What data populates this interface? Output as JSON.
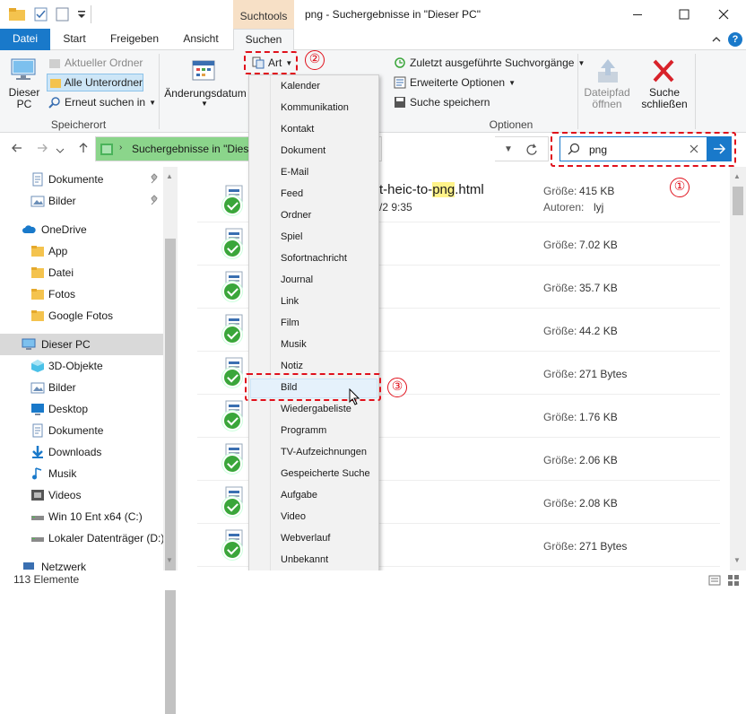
{
  "window": {
    "context_tab": "Suchtools",
    "title": "png - Suchergebnisse in \"Dieser PC\""
  },
  "ribbon_tabs": [
    "Datei",
    "Start",
    "Freigeben",
    "Ansicht",
    "Suchen"
  ],
  "ribbon": {
    "this_pc": "Dieser PC",
    "current_folder": "Aktueller Ordner",
    "all_subfolders": "Alle Unterordner",
    "search_again": "Erneut suchen in",
    "group_location": "Speicherort",
    "date_modified": "Änderungsdatum",
    "kind_button": "Art",
    "recent_searches": "Zuletzt ausgeführte Suchvorgänge",
    "advanced_options": "Erweiterte Optionen",
    "save_search": "Suche speichern",
    "group_options": "Optionen",
    "open_file_location": "Dateipfad öffnen",
    "close_search": "Suche schließen"
  },
  "address": {
    "path": "Suchergebnisse in \"Dieser",
    "search_value": "png"
  },
  "nav": [
    {
      "label": "Dokumente",
      "icon": "document-icon",
      "pinned": true
    },
    {
      "label": "Bilder",
      "icon": "pictures-icon",
      "pinned": true
    },
    {
      "label": "OneDrive",
      "icon": "cloud-icon"
    },
    {
      "label": "App",
      "icon": "folder-icon"
    },
    {
      "label": "Datei",
      "icon": "folder-icon"
    },
    {
      "label": "Fotos",
      "icon": "folder-icon"
    },
    {
      "label": "Google Fotos",
      "icon": "folder-icon"
    },
    {
      "label": "Dieser PC",
      "icon": "computer-icon",
      "selected": true
    },
    {
      "label": "3D-Objekte",
      "icon": "cube-icon"
    },
    {
      "label": "Bilder",
      "icon": "pictures-icon"
    },
    {
      "label": "Desktop",
      "icon": "desktop-icon"
    },
    {
      "label": "Dokumente",
      "icon": "document-icon"
    },
    {
      "label": "Downloads",
      "icon": "download-icon"
    },
    {
      "label": "Musik",
      "icon": "music-icon"
    },
    {
      "label": "Videos",
      "icon": "video-icon"
    },
    {
      "label": "Win 10 Ent x64 (C:)",
      "icon": "drive-icon"
    },
    {
      "label": "Lokaler Datenträger (D:)",
      "icon": "drive-icon"
    },
    {
      "label": "Netzwerk",
      "icon": "network-icon"
    }
  ],
  "results": {
    "first_name_prefix": "t-heic-to-",
    "first_name_match": "png",
    "first_name_suffix": ".html",
    "first_date": "/2 9:35",
    "size_label": "Größe:",
    "authors_label": "Autoren:",
    "first_author": "lyj",
    "sizes": [
      "415 KB",
      "7.02 KB",
      "35.7 KB",
      "44.2 KB",
      "271 Bytes",
      "1.76 KB",
      "2.06 KB",
      "2.08 KB",
      "271 Bytes"
    ]
  },
  "kind_menu": [
    "Kalender",
    "Kommunikation",
    "Kontakt",
    "Dokument",
    "E-Mail",
    "Feed",
    "Ordner",
    "Spiel",
    "Sofortnachricht",
    "Journal",
    "Link",
    "Film",
    "Musik",
    "Notiz",
    "Bild",
    "Wiedergabeliste",
    "Programm",
    "TV-Aufzeichnungen",
    "Gespeicherte Suche",
    "Aufgabe",
    "Video",
    "Webverlauf",
    "Unbekannt"
  ],
  "markers": [
    "①",
    "②",
    "③"
  ],
  "status": {
    "count": "113 Elemente"
  },
  "colors": {
    "accent": "#1979ca",
    "highlight": "#e0101b",
    "context_tab": "#f7e0c6"
  }
}
